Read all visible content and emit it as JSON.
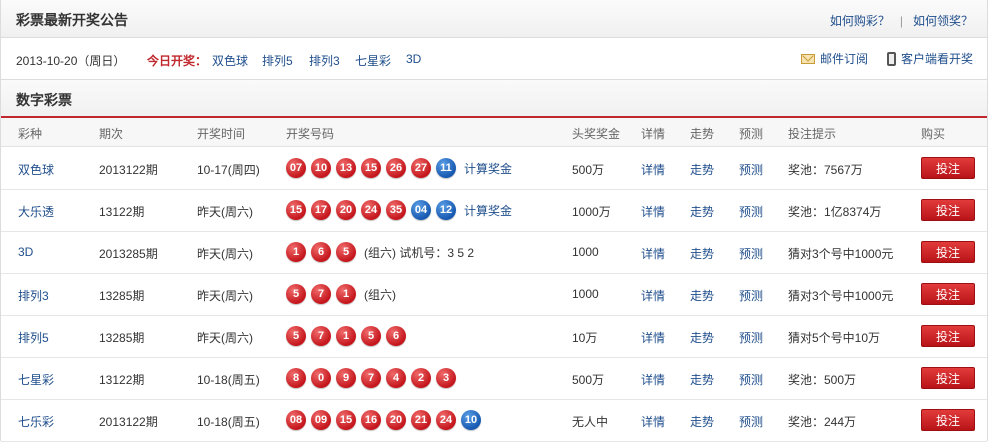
{
  "header": {
    "title": "彩票最新开奖公告",
    "link_how_buy": "如何购彩？",
    "link_separator": "|",
    "link_how_claim": "如何领奖？"
  },
  "subbar": {
    "date": "2013-10-20（周日）",
    "today_label": "今日开奖：",
    "today_lotteries": [
      "双色球",
      "排列5",
      "排列3",
      "七星彩",
      "3D"
    ],
    "mail_subscribe": "邮件订阅",
    "client_view": "客户端看开奖"
  },
  "section": {
    "title": "数字彩票"
  },
  "columns": [
    "彩种",
    "期次",
    "开奖时间",
    "开奖号码",
    "头奖奖金",
    "详情",
    "走势",
    "预测",
    "投注提示",
    "购买"
  ],
  "rows": [
    {
      "name": "双色球",
      "period": "2013122期",
      "time": "10-17(周四)",
      "balls": [
        {
          "n": "07",
          "c": "red"
        },
        {
          "n": "10",
          "c": "red"
        },
        {
          "n": "13",
          "c": "red"
        },
        {
          "n": "15",
          "c": "red"
        },
        {
          "n": "26",
          "c": "red"
        },
        {
          "n": "27",
          "c": "red"
        },
        {
          "n": "11",
          "c": "blue"
        }
      ],
      "extra": "计算奖金",
      "extra_link": true,
      "prize": "500万",
      "detail": "详情",
      "trend": "走势",
      "forecast": "预测",
      "tip": "奖池：7567万",
      "buy": "投注"
    },
    {
      "name": "大乐透",
      "period": "13122期",
      "time": "昨天(周六)",
      "balls": [
        {
          "n": "15",
          "c": "red"
        },
        {
          "n": "17",
          "c": "red"
        },
        {
          "n": "20",
          "c": "red"
        },
        {
          "n": "24",
          "c": "red"
        },
        {
          "n": "35",
          "c": "red"
        },
        {
          "n": "04",
          "c": "blue"
        },
        {
          "n": "12",
          "c": "blue"
        }
      ],
      "extra": "计算奖金",
      "extra_link": true,
      "prize": "1000万",
      "detail": "详情",
      "trend": "走势",
      "forecast": "预测",
      "tip": "奖池：1亿8374万",
      "buy": "投注"
    },
    {
      "name": "3D",
      "period": "2013285期",
      "time": "昨天(周六)",
      "balls": [
        {
          "n": "1",
          "c": "red"
        },
        {
          "n": "6",
          "c": "red"
        },
        {
          "n": "5",
          "c": "red"
        }
      ],
      "extra": "(组六) 试机号：3 5 2",
      "extra_link": false,
      "prize": "1000",
      "detail": "详情",
      "trend": "走势",
      "forecast": "预测",
      "tip": "猜对3个号中1000元",
      "buy": "投注"
    },
    {
      "name": "排列3",
      "period": "13285期",
      "time": "昨天(周六)",
      "balls": [
        {
          "n": "5",
          "c": "red"
        },
        {
          "n": "7",
          "c": "red"
        },
        {
          "n": "1",
          "c": "red"
        }
      ],
      "extra": "(组六)",
      "extra_link": false,
      "prize": "1000",
      "detail": "详情",
      "trend": "走势",
      "forecast": "预测",
      "tip": "猜对3个号中1000元",
      "buy": "投注"
    },
    {
      "name": "排列5",
      "period": "13285期",
      "time": "昨天(周六)",
      "balls": [
        {
          "n": "5",
          "c": "red"
        },
        {
          "n": "7",
          "c": "red"
        },
        {
          "n": "1",
          "c": "red"
        },
        {
          "n": "5",
          "c": "red"
        },
        {
          "n": "6",
          "c": "red"
        }
      ],
      "extra": "",
      "extra_link": false,
      "prize": "10万",
      "detail": "详情",
      "trend": "走势",
      "forecast": "预测",
      "tip": "猜对5个号中10万",
      "buy": "投注"
    },
    {
      "name": "七星彩",
      "period": "13122期",
      "time": "10-18(周五)",
      "balls": [
        {
          "n": "8",
          "c": "red"
        },
        {
          "n": "0",
          "c": "red"
        },
        {
          "n": "9",
          "c": "red"
        },
        {
          "n": "7",
          "c": "red"
        },
        {
          "n": "4",
          "c": "red"
        },
        {
          "n": "2",
          "c": "red"
        },
        {
          "n": "3",
          "c": "red"
        }
      ],
      "extra": "",
      "extra_link": false,
      "prize": "500万",
      "detail": "详情",
      "trend": "走势",
      "forecast": "预测",
      "tip": "奖池：500万",
      "buy": "投注"
    },
    {
      "name": "七乐彩",
      "period": "2013122期",
      "time": "10-18(周五)",
      "balls": [
        {
          "n": "08",
          "c": "red"
        },
        {
          "n": "09",
          "c": "red"
        },
        {
          "n": "15",
          "c": "red"
        },
        {
          "n": "16",
          "c": "red"
        },
        {
          "n": "20",
          "c": "red"
        },
        {
          "n": "21",
          "c": "red"
        },
        {
          "n": "24",
          "c": "red"
        },
        {
          "n": "10",
          "c": "blue"
        }
      ],
      "extra": "",
      "extra_link": false,
      "prize": "无人中",
      "detail": "详情",
      "trend": "走势",
      "forecast": "预测",
      "tip": "奖池：244万",
      "buy": "投注"
    }
  ],
  "colors": {
    "accent_red": "#c1282d",
    "link_blue": "#1f4e8c",
    "ball_red": "#c4161c",
    "ball_blue": "#1759b0"
  }
}
